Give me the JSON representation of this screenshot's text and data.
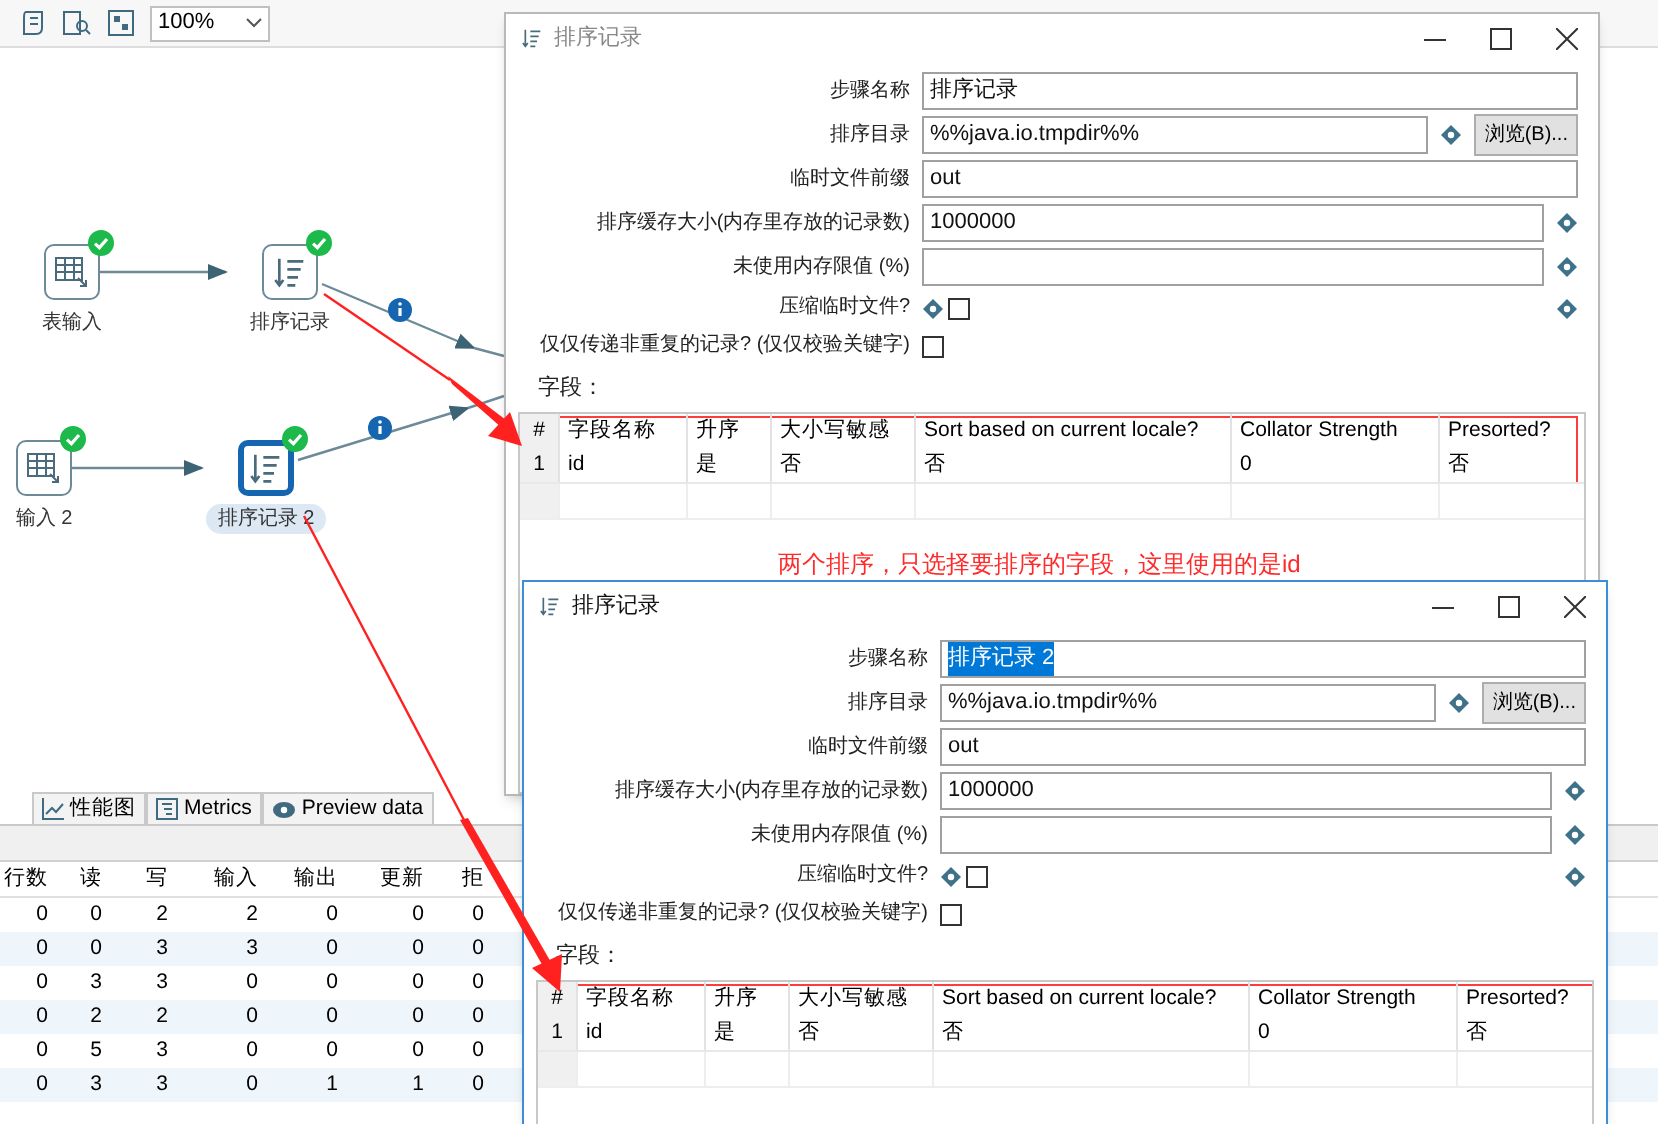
{
  "toolbar": {
    "zoom": "100%"
  },
  "canvas": {
    "nodes": [
      {
        "label": "表输入",
        "kind": "table-input",
        "selected": false
      },
      {
        "label": "排序记录",
        "kind": "sort",
        "selected": false
      },
      {
        "label": "输入 2",
        "kind": "table-input",
        "selected": false
      },
      {
        "label": "排序记录 2",
        "kind": "sort",
        "selected": true
      }
    ]
  },
  "bottom_panel": {
    "tabs": [
      {
        "label": "性能图",
        "kind": "chart",
        "selected": false
      },
      {
        "label": "Metrics",
        "kind": "metrics",
        "selected": false
      },
      {
        "label": "Preview data",
        "kind": "preview",
        "selected": false
      }
    ],
    "columns": [
      "行数",
      "读",
      "写",
      "输入",
      "输出",
      "更新",
      "拒"
    ],
    "rows": [
      [
        "0",
        "0",
        "2",
        "2",
        "0",
        "0",
        "0"
      ],
      [
        "0",
        "0",
        "3",
        "3",
        "0",
        "0",
        "0"
      ],
      [
        "0",
        "3",
        "3",
        "0",
        "0",
        "0",
        "0"
      ],
      [
        "0",
        "2",
        "2",
        "0",
        "0",
        "0",
        "0"
      ],
      [
        "0",
        "5",
        "3",
        "0",
        "0",
        "0",
        "0"
      ],
      [
        "0",
        "3",
        "3",
        "0",
        "1",
        "1",
        "0"
      ]
    ]
  },
  "annotation": "两个排序，只选择要排序的字段，这里使用的是id",
  "dialogs": [
    {
      "title": "排序记录",
      "fields": [
        {
          "kind": "text",
          "label": "步骤名称",
          "value": "排序记录",
          "highlighted": false,
          "variable": false
        },
        {
          "kind": "text",
          "label": "排序目录",
          "value": "%%java.io.tmpdir%%",
          "variable": true,
          "button": "浏览(B)..."
        },
        {
          "kind": "text",
          "label": "临时文件前缀",
          "value": "out",
          "variable": false
        },
        {
          "kind": "text",
          "label": "排序缓存大小(内存里存放的记录数)",
          "value": "1000000",
          "variable": true
        },
        {
          "kind": "text",
          "label": "未使用内存限值 (%)",
          "variable": true
        },
        {
          "kind": "checkbox",
          "label": "压缩临时文件?",
          "checked": false,
          "variable": true,
          "trailing_variable": true
        },
        {
          "kind": "checkbox",
          "label": "仅仅传递非重复的记录? (仅仅校验关键字)",
          "checked": false,
          "variable": false
        }
      ],
      "fields_label": "字段：",
      "table": {
        "columns": [
          "#",
          "字段名称",
          "升序",
          "大小写敏感",
          "Sort based on current locale?",
          "Collator Strength",
          "Presorted?"
        ],
        "rows": [
          [
            "1",
            "id",
            "是",
            "否",
            "否",
            "0",
            "否"
          ]
        ]
      }
    },
    {
      "title": "排序记录",
      "fields": [
        {
          "kind": "text",
          "label": "步骤名称",
          "value": "排序记录 2",
          "highlighted": true,
          "variable": false
        },
        {
          "kind": "text",
          "label": "排序目录",
          "value": "%%java.io.tmpdir%%",
          "variable": true,
          "button": "浏览(B)..."
        },
        {
          "kind": "text",
          "label": "临时文件前缀",
          "value": "out",
          "variable": false
        },
        {
          "kind": "text",
          "label": "排序缓存大小(内存里存放的记录数)",
          "value": "1000000",
          "variable": true
        },
        {
          "kind": "text",
          "label": "未使用内存限值 (%)",
          "variable": true
        },
        {
          "kind": "checkbox",
          "label": "压缩临时文件?",
          "checked": false,
          "variable": true,
          "trailing_variable": true
        },
        {
          "kind": "checkbox",
          "label": "仅仅传递非重复的记录? (仅仅校验关键字)",
          "checked": false,
          "variable": false
        }
      ],
      "fields_label": "字段：",
      "table": {
        "columns": [
          "#",
          "字段名称",
          "升序",
          "大小写敏感",
          "Sort based on current locale?",
          "Collator Strength",
          "Presorted?"
        ],
        "rows": [
          [
            "1",
            "id",
            "是",
            "否",
            "否",
            "0",
            "否"
          ]
        ]
      }
    }
  ]
}
